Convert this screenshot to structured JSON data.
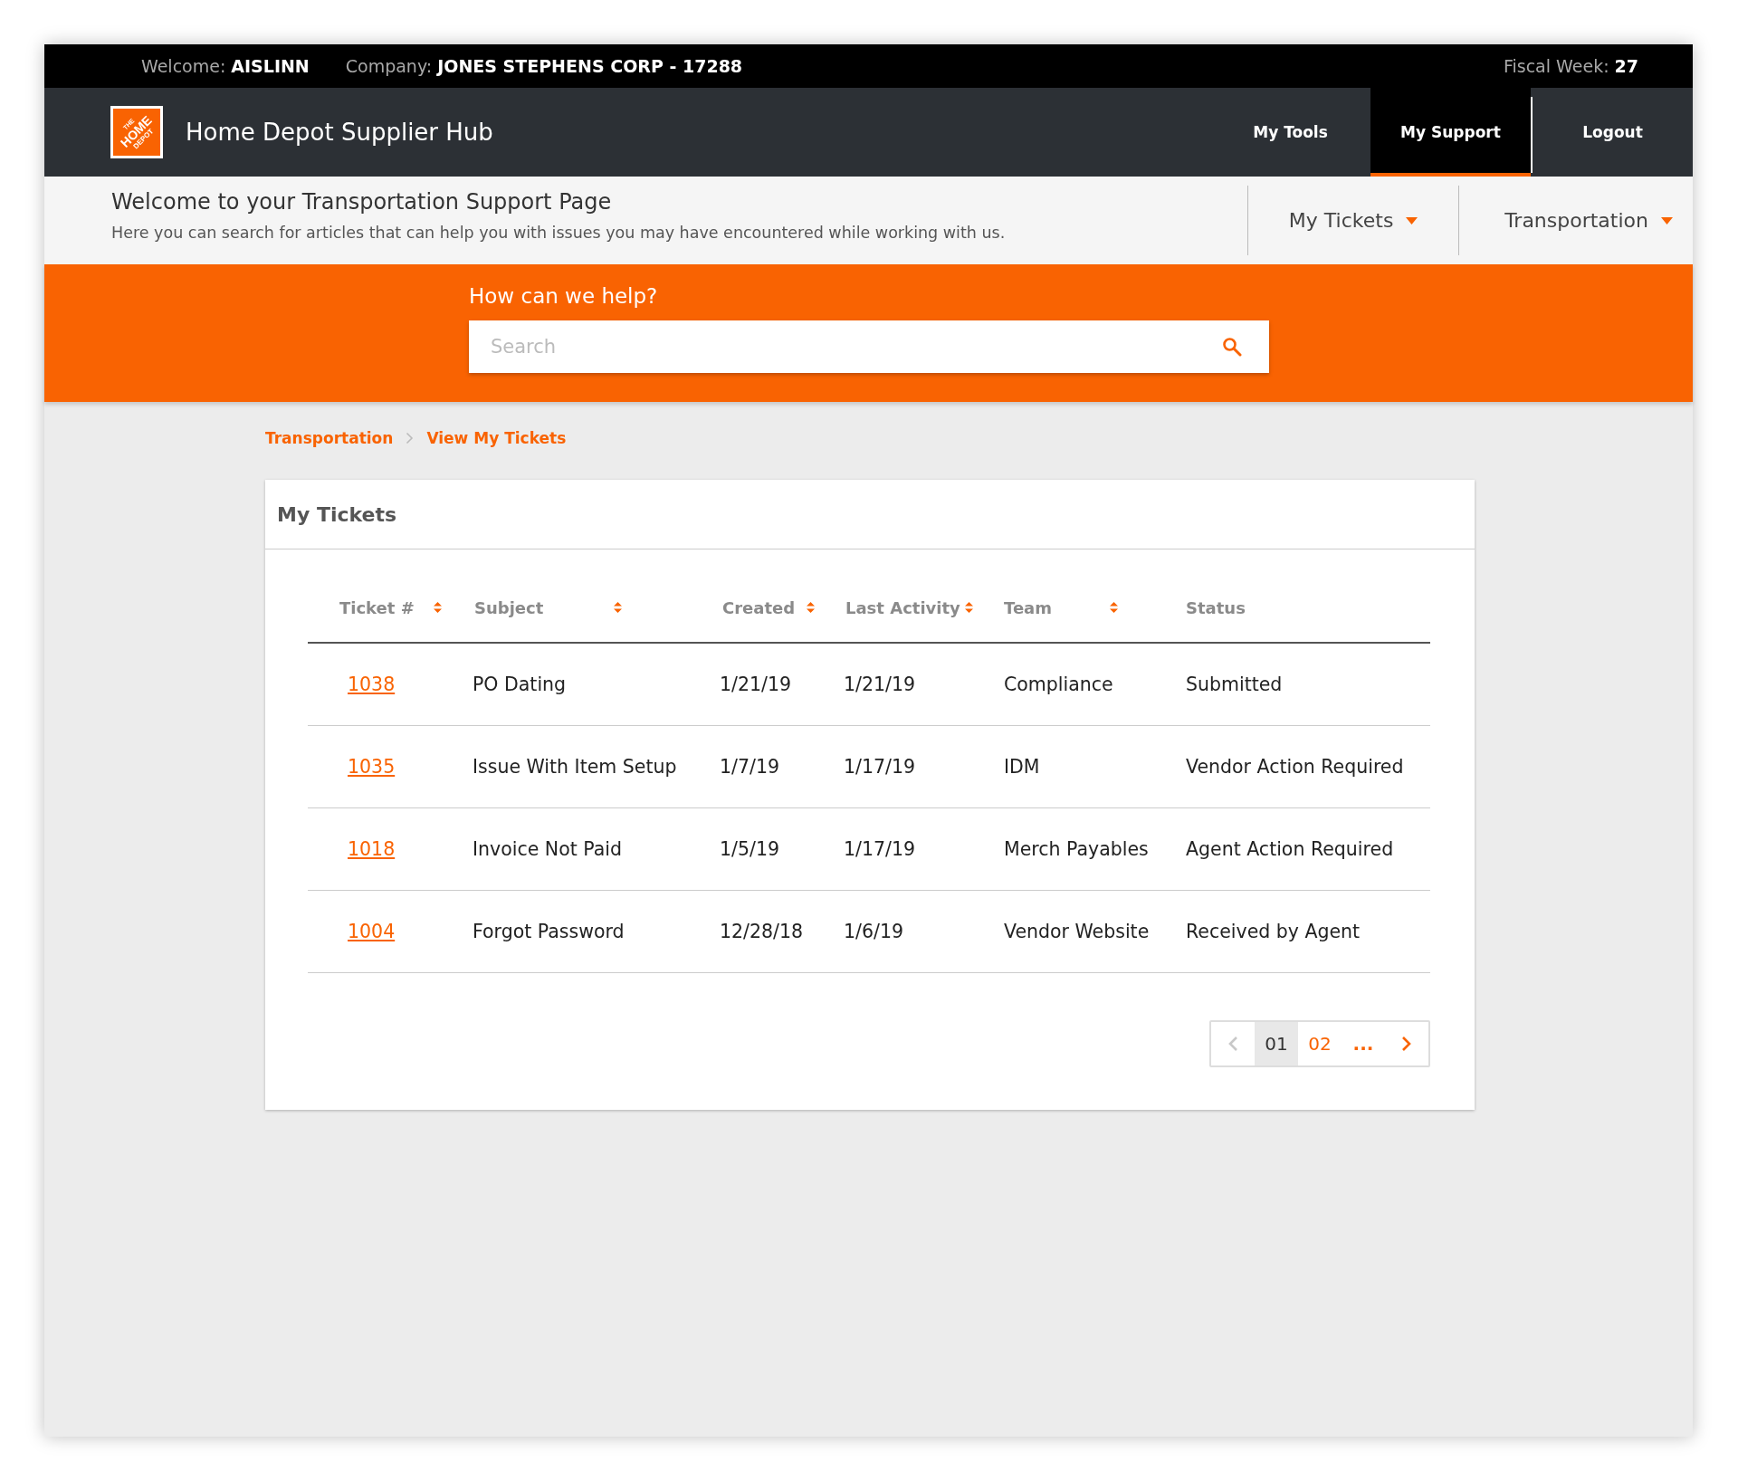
{
  "top_bar": {
    "welcome_label": "Welcome:",
    "welcome_value": "AISLINN",
    "company_label": "Company:",
    "company_value": "JONES STEPHENS CORP - 17288",
    "fiscal_label": "Fiscal Week:",
    "fiscal_value": "27"
  },
  "nav": {
    "logo_lines": [
      "THE",
      "HOME",
      "DEPOT"
    ],
    "title": "Home Depot Supplier Hub",
    "items": [
      {
        "label": "My Tools",
        "selected": false
      },
      {
        "label": "My Support",
        "selected": true
      },
      {
        "label": "Logout",
        "selected": false
      }
    ]
  },
  "subheader": {
    "title": "Welcome to your Transportation Support Page",
    "subtitle": "Here you can search for articles that can help you with issues you may have encountered while working with us.",
    "dropdowns": [
      "My Tickets",
      "Transportation"
    ]
  },
  "search": {
    "heading": "How can we help?",
    "placeholder": "Search"
  },
  "breadcrumb": [
    "Transportation",
    "View My Tickets"
  ],
  "card": {
    "title": "My Tickets",
    "table": {
      "columns": [
        {
          "label": "Ticket #",
          "sortable": true
        },
        {
          "label": "Subject",
          "sortable": true
        },
        {
          "label": "Created",
          "sortable": true
        },
        {
          "label": "Last Activity",
          "sortable": true
        },
        {
          "label": "Team",
          "sortable": true
        },
        {
          "label": "Status",
          "sortable": false
        }
      ],
      "rows": [
        [
          "1038",
          "PO Dating",
          "1/21/19",
          "1/21/19",
          "Compliance",
          "Submitted"
        ],
        [
          "1035",
          "Issue With Item Setup",
          "1/7/19",
          "1/17/19",
          "IDM",
          "Vendor Action Required"
        ],
        [
          "1018",
          "Invoice Not Paid",
          "1/5/19",
          "1/17/19",
          "Merch Payables",
          "Agent Action Required"
        ],
        [
          "1004",
          "Forgot Password",
          "12/28/18",
          "1/6/19",
          "Vendor Website",
          "Received by Agent"
        ]
      ]
    },
    "pagination": {
      "prev_disabled": true,
      "pages": [
        {
          "label": "01",
          "selected": true
        },
        {
          "label": "02",
          "selected": false
        }
      ],
      "more": "...",
      "next_disabled": false
    }
  }
}
